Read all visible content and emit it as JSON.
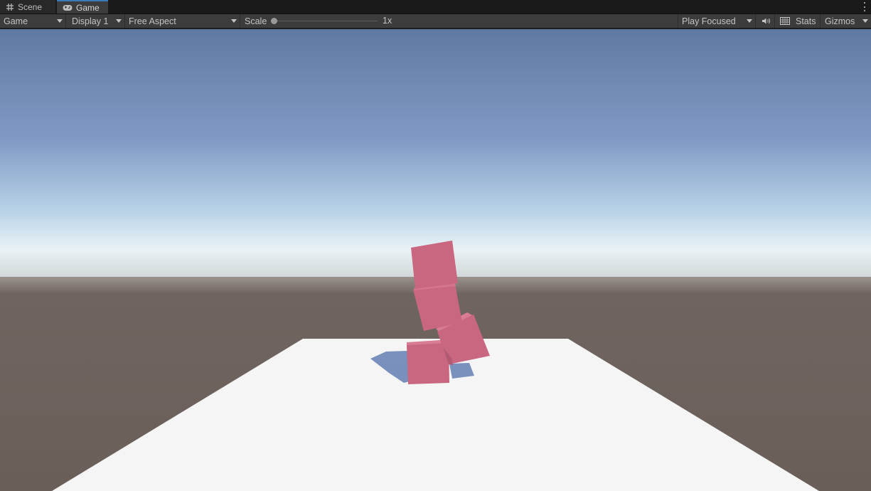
{
  "tabs": [
    {
      "label": "Scene",
      "icon": "grid-icon",
      "active": false
    },
    {
      "label": "Game",
      "icon": "gamepad-icon",
      "active": true
    }
  ],
  "toolbar": {
    "view_dropdown": "Game",
    "display_dropdown": "Display 1",
    "aspect_dropdown": "Free Aspect",
    "scale_label": "Scale",
    "scale_value": "1x",
    "scale_slider_fraction": 0.0,
    "play_mode_dropdown": "Play Focused",
    "audio_icon": "speaker-icon",
    "stats_icon": "stats-grid-icon",
    "stats_label": "Stats",
    "gizmos_label": "Gizmos"
  },
  "colors": {
    "editor_bg": "#191919",
    "toolbar_bg": "#3c3c3c",
    "active_tab_accent": "#3a79bb",
    "sky_top": "#5f7aa2",
    "horizon_glow": "#e9f2f6",
    "ground": "#6b5f59",
    "plane": "#f5f5f5",
    "cube": "#c96680",
    "shadow": "#6f88b8"
  }
}
